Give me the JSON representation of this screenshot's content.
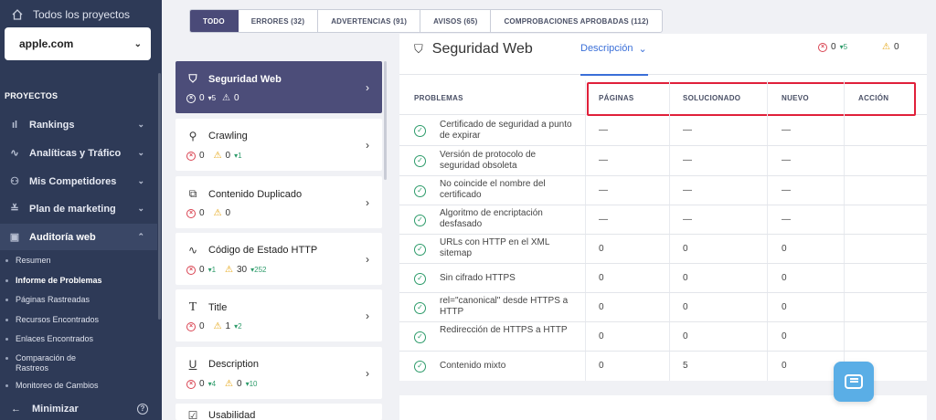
{
  "sidebar": {
    "all_projects": "Todos los proyectos",
    "project": "apple.com",
    "section_label": "PROYECTOS",
    "items": [
      {
        "label": "Rankings",
        "icon": "bar-chart-icon"
      },
      {
        "label": "Analíticas y Tráfico",
        "icon": "pulse-icon"
      },
      {
        "label": "Mis Competidores",
        "icon": "users-icon"
      },
      {
        "label": "Plan de marketing",
        "icon": "list-check-icon"
      },
      {
        "label": "Auditoría web",
        "icon": "audit-icon"
      }
    ],
    "subitems": [
      "Resumen",
      "Informe de Problemas",
      "Páginas Rastreadas",
      "Recursos Encontrados",
      "Enlaces Encontrados",
      "Comparación de Rastreos",
      "Monitoreo de Cambios"
    ],
    "minimize": "Minimizar"
  },
  "tabs": [
    "TODO",
    "ERRORES (32)",
    "ADVERTENCIAS (91)",
    "AVISOS (65)",
    "COMPROBACIONES APROBADAS (112)"
  ],
  "categories": [
    {
      "name": "Seguridad Web",
      "err": "0",
      "err_delta": "5",
      "warn": "0",
      "warn_delta": ""
    },
    {
      "name": "Crawling",
      "err": "0",
      "err_delta": "",
      "warn": "0",
      "warn_delta": "1"
    },
    {
      "name": "Contenido Duplicado",
      "err": "0",
      "err_delta": "",
      "warn": "0",
      "warn_delta": ""
    },
    {
      "name": "Código de Estado HTTP",
      "err": "0",
      "err_delta": "1",
      "warn": "30",
      "warn_delta": "252"
    },
    {
      "name": "Title",
      "err": "0",
      "err_delta": "",
      "warn": "1",
      "warn_delta": "2"
    },
    {
      "name": "Description",
      "err": "0",
      "err_delta": "4",
      "warn": "0",
      "warn_delta": "10"
    },
    {
      "name": "Usabilidad",
      "err": "",
      "err_delta": "",
      "warn": "",
      "warn_delta": ""
    }
  ],
  "panel": {
    "title": "Seguridad Web",
    "desc": "Descripción",
    "err": "0",
    "err_delta": "5",
    "warn": "0"
  },
  "table": {
    "headers": [
      "PROBLEMAS",
      "PÁGINAS",
      "SOLUCIONADO",
      "NUEVO",
      "ACCIÓN"
    ],
    "rows": [
      {
        "problem": "Certificado de seguridad a punto de expirar",
        "pages": "—",
        "solved": "—",
        "new": "—"
      },
      {
        "problem": "Versión de protocolo de seguridad obsoleta",
        "pages": "—",
        "solved": "—",
        "new": "—"
      },
      {
        "problem": "No coincide el nombre del certificado",
        "pages": "—",
        "solved": "—",
        "new": "—"
      },
      {
        "problem": "Algoritmo de encriptación desfasado",
        "pages": "—",
        "solved": "—",
        "new": "—"
      },
      {
        "problem": "URLs con HTTP en el XML sitemap",
        "pages": "0",
        "solved": "0",
        "new": "0"
      },
      {
        "problem": "Sin cifrado HTTPS",
        "pages": "0",
        "solved": "0",
        "new": "0"
      },
      {
        "problem": "rel=\"canonical\" desde HTTPS a HTTP",
        "pages": "0",
        "solved": "0",
        "new": "0"
      },
      {
        "problem": "Redirección de HTTPS a HTTP",
        "pages": "0",
        "solved": "0",
        "new": "0"
      },
      {
        "problem": "Contenido mixto",
        "pages": "0",
        "solved": "5",
        "new": "0"
      }
    ]
  },
  "colors": {
    "sidebar": "#2e3a57",
    "active_tab": "#4a4a78",
    "accent": "#3a6fd8",
    "error": "#d94452",
    "warning": "#e5a40f",
    "ok": "#2d9b6a",
    "highlight": "#e0203a"
  }
}
